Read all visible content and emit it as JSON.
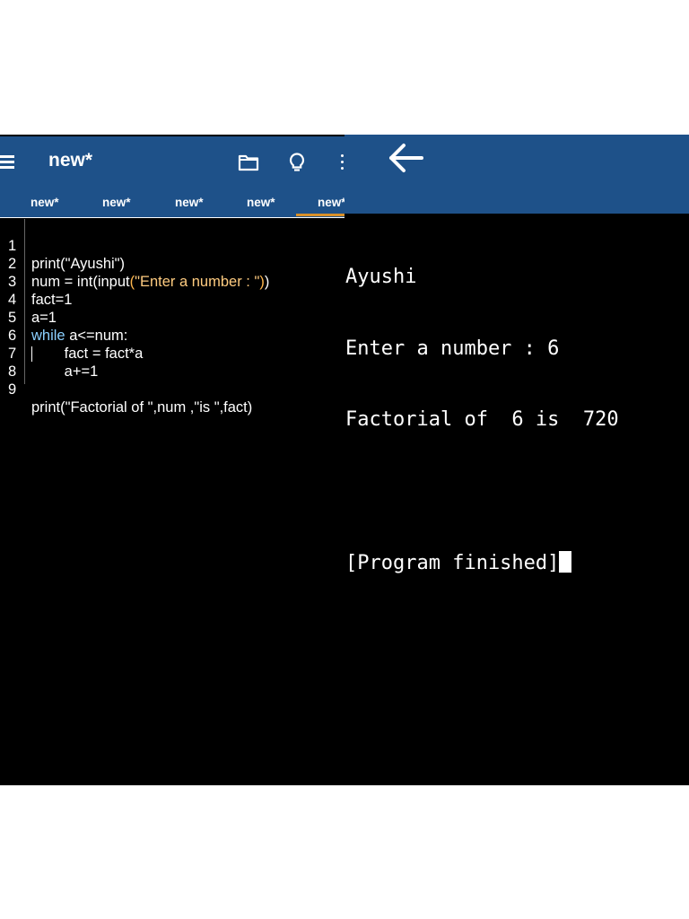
{
  "editor": {
    "title": "new*",
    "icons": [
      "menu-icon",
      "folder-icon",
      "bulb-icon",
      "more-vert-icon"
    ],
    "tabs": [
      "new*",
      "new*",
      "new*",
      "new*",
      "new*"
    ],
    "accent_color": "#1e5189",
    "active_tab_color": "#d8902a",
    "lines": [
      {
        "n": "1",
        "text": "print(\"Ayushi\")"
      },
      {
        "n": "2",
        "text": "num = int(input(\"Enter a number : \"))"
      },
      {
        "n": "3",
        "text": "fact=1"
      },
      {
        "n": "4",
        "text": "a=1"
      },
      {
        "n": "5",
        "text": "while a<=num:"
      },
      {
        "n": "6",
        "text": "        fact = fact*a"
      },
      {
        "n": "7",
        "text": "        a+=1"
      },
      {
        "n": "8",
        "text": "print(\"Factorial of \",num ,\"is \",fact)"
      },
      {
        "n": "9",
        "text": ""
      }
    ],
    "code_parts": {
      "l1": "print(\"Ayushi\")",
      "l2a": "num = int(input",
      "l2b": "(",
      "l2c": "\"Enter a number : \"",
      "l2d": ")",
      "l2e": ")",
      "l3": "fact=1",
      "l4": "a=1",
      "l5kw": "while",
      "l5rest": " a<=num:",
      "l6": "        fact = fact*a",
      "l7": "        a+=1",
      "l8": "print(\"Factorial of \",num ,\"is \",fact)"
    }
  },
  "terminal": {
    "back_icon": "arrow-left-icon",
    "output": [
      "Ayushi",
      "Enter a number : 6",
      "Factorial of  6 is  720",
      "",
      "[Program finished]"
    ]
  }
}
